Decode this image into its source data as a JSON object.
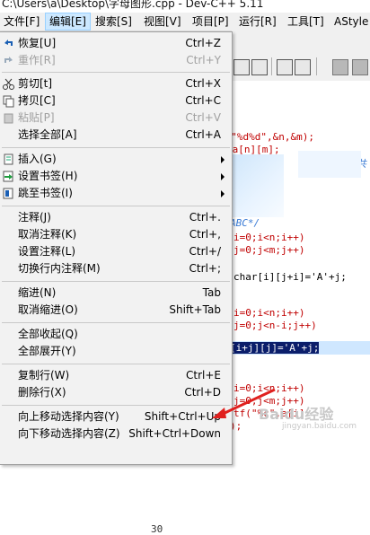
{
  "window": {
    "title": "C:\\Users\\a\\Desktop\\字母图形.cpp - Dev-C++ 5.11"
  },
  "menubar": {
    "items": [
      {
        "label": "文件[F]"
      },
      {
        "label": "编辑[E]"
      },
      {
        "label": "搜索[S]"
      },
      {
        "label": "视图[V]"
      },
      {
        "label": "项目[P]"
      },
      {
        "label": "运行[R]"
      },
      {
        "label": "工具[T]"
      },
      {
        "label": "AStyle"
      }
    ],
    "active_index": 1
  },
  "edit_menu": {
    "items": [
      {
        "label": "恢复[U]",
        "shortcut": "Ctrl+Z",
        "enabled": true,
        "icon": "undo-icon"
      },
      {
        "label": "重作[R]",
        "shortcut": "Ctrl+Y",
        "enabled": false,
        "icon": "redo-icon"
      },
      {
        "label": "剪切[t]",
        "shortcut": "Ctrl+X",
        "enabled": true,
        "icon": "scissors-icon"
      },
      {
        "label": "拷贝[C]",
        "shortcut": "Ctrl+C",
        "enabled": true,
        "icon": "copy-icon"
      },
      {
        "label": "粘贴[P]",
        "shortcut": "Ctrl+V",
        "enabled": false,
        "icon": "paste-icon"
      },
      {
        "label": "选择全部[A]",
        "shortcut": "Ctrl+A",
        "enabled": true
      },
      {
        "label": "插入(G)",
        "submenu": true,
        "enabled": true,
        "icon": "insert-icon"
      },
      {
        "label": "设置书签(H)",
        "submenu": true,
        "enabled": true,
        "icon": "set-bookmark-icon"
      },
      {
        "label": "跳至书签(I)",
        "submenu": true,
        "enabled": true,
        "icon": "goto-bookmark-icon"
      },
      {
        "label": "注释(J)",
        "shortcut": "Ctrl+.",
        "enabled": true
      },
      {
        "label": "取消注释(K)",
        "shortcut": "Ctrl+,",
        "enabled": true
      },
      {
        "label": "设置注释(L)",
        "shortcut": "Ctrl+/",
        "enabled": true
      },
      {
        "label": "切换行内注释(M)",
        "shortcut": "Ctrl+;",
        "enabled": true
      },
      {
        "label": "缩进(N)",
        "shortcut": "Tab",
        "enabled": true
      },
      {
        "label": "取消缩进(O)",
        "shortcut": "Shift+Tab",
        "enabled": true
      },
      {
        "label": "全部收起(Q)",
        "enabled": true
      },
      {
        "label": "全部展开(Y)",
        "enabled": true
      },
      {
        "label": "复制行(W)",
        "shortcut": "Ctrl+E",
        "enabled": true
      },
      {
        "label": "删除行(X)",
        "shortcut": "Ctrl+D",
        "enabled": true
      },
      {
        "label": "向上移动选择内容(Y)",
        "shortcut": "Shift+Ctrl+Up",
        "enabled": true
      },
      {
        "label": "向下移动选择内容(Z)",
        "shortcut": "Shift+Ctrl+Down",
        "enabled": true
      }
    ]
  },
  "editor": {
    "lines": [
      {
        "text": "f(\"%d%d\",&n,&m);",
        "style": "red"
      },
      {
        "text": " a[n][m];",
        "style": "red"
      },
      {
        "text": "一共",
        "style": "cmt"
      },
      {
        "text": "ABC*/",
        "style": "cmt"
      },
      {
        "text": "i=0;i<n;i++)",
        "style": "red"
      },
      {
        "text": "j=0;j<m;j++)",
        "style": "red"
      },
      {
        "text": "char[i][j+i]='A'+j;",
        "style": "plain"
      },
      {
        "text": "i=0;i<n;i++)",
        "style": "red"
      },
      {
        "text": "j=0;j<n-i;j++)",
        "style": "red"
      },
      {
        "text": "i=0;i<n;i++)",
        "style": "red"
      },
      {
        "text": "j=0;j<m;j++)",
        "style": "red"
      },
      {
        "text": "tf(\"%c\",a[i]",
        "style": "red"
      },
      {
        "text": ");",
        "style": "red"
      },
      {
        "text": "}",
        "style": "red"
      }
    ],
    "selected_text": "[i+j][j]='A'+j;",
    "visible_line_number": "30"
  },
  "watermark": {
    "text": "Baidu经验",
    "url": "jingyan.baidu.com"
  }
}
